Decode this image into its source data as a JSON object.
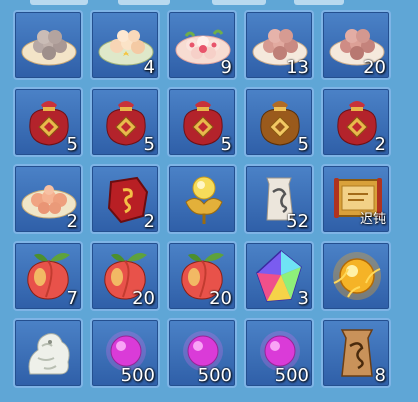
{
  "inventory": {
    "slots": [
      {
        "item": "grey-dumpling-plate-icon",
        "count": ""
      },
      {
        "item": "peach-dumpling-plate-icon",
        "count": "4"
      },
      {
        "item": "flower-dumpling-plate-icon",
        "count": "9"
      },
      {
        "item": "pink-dumpling-plate-icon",
        "count": "13"
      },
      {
        "item": "pink-dumpling-plate-icon",
        "count": "20"
      },
      {
        "item": "red-gift-bag-icon",
        "count": "5"
      },
      {
        "item": "red-gift-bag-icon",
        "count": "5"
      },
      {
        "item": "red-gift-bag-icon",
        "count": "5"
      },
      {
        "item": "brown-gift-bag-icon",
        "count": "5"
      },
      {
        "item": "red-gift-bag-icon",
        "count": "2"
      },
      {
        "item": "peach-dumpling-plate-icon",
        "count": "2"
      },
      {
        "item": "red-talisman-stone-icon",
        "count": "2"
      },
      {
        "item": "golden-orb-lotus-icon",
        "count": ""
      },
      {
        "item": "paper-scroll-icon",
        "count": "52"
      },
      {
        "item": "golden-scroll-icon",
        "count": "迟钝"
      },
      {
        "item": "peach-fruit-icon",
        "count": "7"
      },
      {
        "item": "peach-fruit-icon",
        "count": "20"
      },
      {
        "item": "peach-fruit-icon",
        "count": "20"
      },
      {
        "item": "rainbow-crystal-icon",
        "count": "3"
      },
      {
        "item": "glowing-gold-orb-icon",
        "count": ""
      },
      {
        "item": "jade-beast-statue-icon",
        "count": ""
      },
      {
        "item": "magenta-pearl-icon",
        "count": "500"
      },
      {
        "item": "magenta-pearl-icon",
        "count": "500"
      },
      {
        "item": "magenta-pearl-icon",
        "count": "500"
      },
      {
        "item": "brown-scroll-icon",
        "count": "8"
      }
    ]
  }
}
